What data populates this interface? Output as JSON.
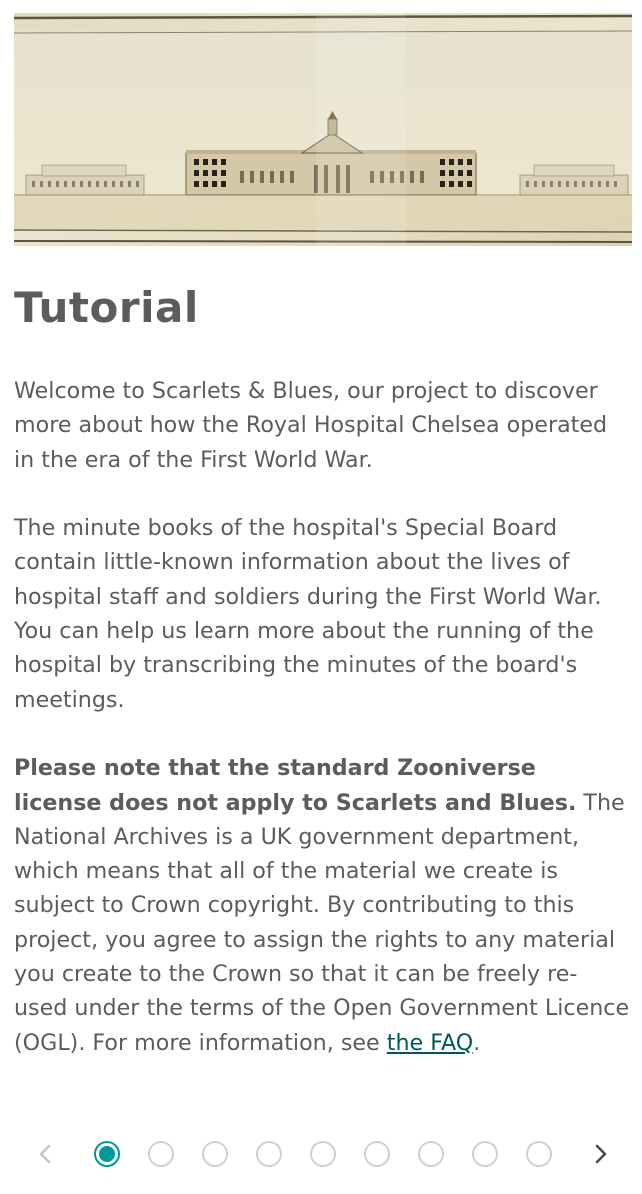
{
  "banner": {
    "description_icon": "architectural-drawing-image"
  },
  "tutorial": {
    "title": "Tutorial",
    "para1": "Welcome to Scarlets & Blues, our project to discover more about how the Royal Hospital Chelsea operated in the era of the First World War.",
    "para2": "The minute books of the hospital's Special Board contain little-known information about the lives of hospital staff and soldiers during the First World War. You can help us learn more about the running of the hospital by transcribing the minutes of the board's meetings.",
    "para3_bold": "Please note that the standard Zooniverse license does not apply to Scarlets and Blues.",
    "para3_rest": " The National Archives is a UK government department, which means that all of the material we create is subject to Crown copyright. By contributing to this project, you agree to assign the rights to any material you create to the Crown so that it can be freely re-used under the terms of the Open Government Licence (OGL). For more information, see ",
    "faq_link": "the FAQ",
    "para3_end": "."
  },
  "pager": {
    "total_steps": 9,
    "active_step": 1,
    "prev_icon": "chevron-left-icon",
    "next_icon": "chevron-right-icon"
  },
  "colors": {
    "accent": "#00979d",
    "text": "#5c5c5c",
    "link": "#00585c",
    "inactive_dot": "#d0d0d0"
  }
}
